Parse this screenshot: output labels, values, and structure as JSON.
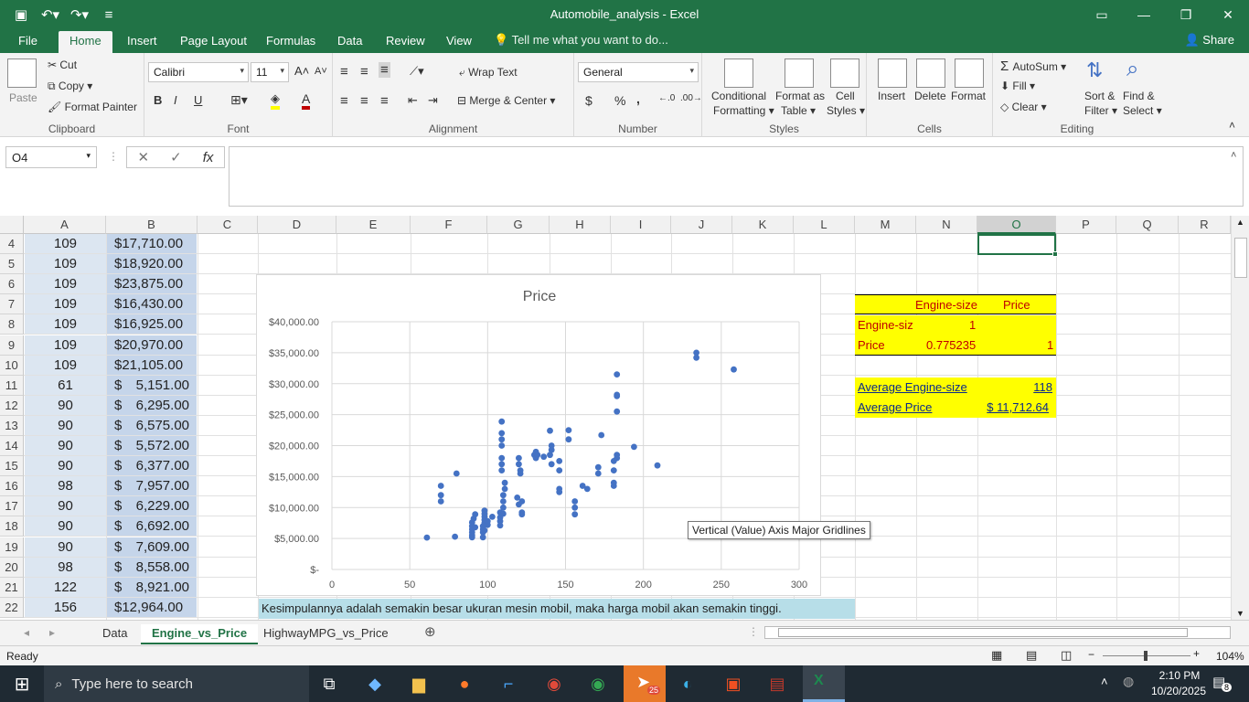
{
  "title_bar": {
    "title": "Automobile_analysis  -  Excel",
    "qat": [
      "save-icon",
      "undo-icon",
      "redo-icon",
      "customize-icon"
    ],
    "window_controls": [
      "ribbon-display-icon",
      "minimize-icon",
      "restore-icon",
      "close-icon"
    ]
  },
  "tabs": {
    "items": [
      "File",
      "Home",
      "Insert",
      "Page Layout",
      "Formulas",
      "Data",
      "Review",
      "View"
    ],
    "active": "Home",
    "tell_me": "Tell me what you want to do...",
    "share": "Share"
  },
  "ribbon": {
    "clipboard": {
      "paste": "Paste",
      "cut": "Cut",
      "copy": "Copy",
      "format_painter": "Format Painter",
      "label": "Clipboard"
    },
    "font": {
      "name": "Calibri",
      "size": "11",
      "bold": "B",
      "italic": "I",
      "underline": "U",
      "label": "Font"
    },
    "alignment": {
      "wrap": "Wrap Text",
      "merge": "Merge & Center",
      "label": "Alignment"
    },
    "number": {
      "format": "General",
      "currency": "$",
      "percent": "%",
      "comma": ",",
      "label": "Number"
    },
    "styles": {
      "conditional": "Conditional",
      "conditional2": "Formatting",
      "format_as": "Format as",
      "format_as2": "Table",
      "cell": "Cell",
      "cell2": "Styles",
      "label": "Styles"
    },
    "cells": {
      "insert": "Insert",
      "delete": "Delete",
      "format": "Format",
      "label": "Cells"
    },
    "editing": {
      "autosum": "AutoSum",
      "fill": "Fill",
      "clear": "Clear",
      "sort": "Sort &",
      "sort2": "Filter",
      "find": "Find &",
      "find2": "Select",
      "label": "Editing"
    }
  },
  "formula_bar": {
    "name_box": "O4",
    "fx": "fx",
    "content": ""
  },
  "columns": [
    "A",
    "B",
    "C",
    "D",
    "E",
    "F",
    "G",
    "H",
    "I",
    "J",
    "K",
    "L",
    "M",
    "N",
    "O",
    "P",
    "Q",
    "R"
  ],
  "selected_column": "O",
  "rows": [
    {
      "n": "4",
      "a": "109",
      "b_cur": "",
      "b": "$17,710.00"
    },
    {
      "n": "5",
      "a": "109",
      "b_cur": "",
      "b": "$18,920.00"
    },
    {
      "n": "6",
      "a": "109",
      "b_cur": "",
      "b": "$23,875.00"
    },
    {
      "n": "7",
      "a": "109",
      "b_cur": "",
      "b": "$16,430.00"
    },
    {
      "n": "8",
      "a": "109",
      "b_cur": "",
      "b": "$16,925.00"
    },
    {
      "n": "9",
      "a": "109",
      "b_cur": "",
      "b": "$20,970.00"
    },
    {
      "n": "10",
      "a": "109",
      "b_cur": "",
      "b": "$21,105.00"
    },
    {
      "n": "11",
      "a": "61",
      "b_cur": "$",
      "b": "5,151.00"
    },
    {
      "n": "12",
      "a": "90",
      "b_cur": "$",
      "b": "6,295.00"
    },
    {
      "n": "13",
      "a": "90",
      "b_cur": "$",
      "b": "6,575.00"
    },
    {
      "n": "14",
      "a": "90",
      "b_cur": "$",
      "b": "5,572.00"
    },
    {
      "n": "15",
      "a": "90",
      "b_cur": "$",
      "b": "6,377.00"
    },
    {
      "n": "16",
      "a": "98",
      "b_cur": "$",
      "b": "7,957.00"
    },
    {
      "n": "17",
      "a": "90",
      "b_cur": "$",
      "b": "6,229.00"
    },
    {
      "n": "18",
      "a": "90",
      "b_cur": "$",
      "b": "6,692.00"
    },
    {
      "n": "19",
      "a": "90",
      "b_cur": "$",
      "b": "7,609.00"
    },
    {
      "n": "20",
      "a": "98",
      "b_cur": "$",
      "b": "8,558.00"
    },
    {
      "n": "21",
      "a": "122",
      "b_cur": "$",
      "b": "8,921.00"
    },
    {
      "n": "22",
      "a": "156",
      "b_cur": "",
      "b": "$12,964.00"
    }
  ],
  "correlation": {
    "header_col1": "Engine-size",
    "header_col2": "Price",
    "row1_label": "Engine-siz",
    "row1_v1": "1",
    "row2_label": "Price",
    "row2_v1": "0.775235",
    "row2_v2": "1",
    "avg_engine_label": "Average Engine-size",
    "avg_engine_value": "118",
    "avg_price_label": "Average Price",
    "avg_price_value": "$ 11,712.64"
  },
  "chart_tooltip": "Vertical (Value) Axis Major Gridlines",
  "conclusion": "Kesimpulannya adalah semakin besar ukuran mesin mobil, maka harga mobil akan semakin tinggi.",
  "sheets": [
    "Data",
    "Engine_vs_Price",
    "HighwayMPG_vs_Price"
  ],
  "active_sheet": "Engine_vs_Price",
  "status": {
    "ready": "Ready",
    "zoom": "104%"
  },
  "taskbar": {
    "search": "Type here to search",
    "time": "2:10 PM",
    "date": "10/20/2025",
    "telegram_badge": "25",
    "notif": "8"
  },
  "chart_data": {
    "type": "scatter",
    "title": "Price",
    "xlim": [
      0,
      300
    ],
    "ylim": [
      0,
      40000
    ],
    "x_ticks": [
      "0",
      "50",
      "100",
      "150",
      "200",
      "250",
      "300"
    ],
    "y_ticks": [
      "$-",
      "$5,000.00",
      "$10,000.00",
      "$15,000.00",
      "$20,000.00",
      "$25,000.00",
      "$30,000.00",
      "$35,000.00",
      "$40,000.00"
    ],
    "grid": true,
    "x": [
      61,
      70,
      70,
      70,
      79,
      80,
      90,
      90,
      90,
      90,
      90,
      90,
      91,
      92,
      92,
      97,
      97,
      97,
      97,
      98,
      98,
      98,
      98,
      98,
      98,
      100,
      100,
      103,
      108,
      108,
      108,
      108,
      109,
      109,
      109,
      109,
      109,
      109,
      109,
      110,
      110,
      110,
      110,
      111,
      111,
      119,
      120,
      120,
      120,
      121,
      121,
      122,
      122,
      122,
      130,
      131,
      131,
      132,
      136,
      140,
      140,
      141,
      141,
      141,
      146,
      146,
      146,
      146,
      152,
      152,
      156,
      156,
      156,
      161,
      164,
      171,
      171,
      173,
      181,
      181,
      181,
      181,
      183,
      183,
      183,
      183,
      183,
      183,
      194,
      209,
      234,
      234,
      258
    ],
    "y": [
      5151,
      11000,
      12000,
      13500,
      5300,
      15500,
      5200,
      5500,
      6000,
      6500,
      7000,
      7600,
      8200,
      8900,
      6800,
      5200,
      6000,
      6500,
      7000,
      7500,
      8000,
      8500,
      9000,
      9500,
      6300,
      7200,
      7800,
      8500,
      7100,
      7800,
      8400,
      9200,
      16000,
      17000,
      18000,
      20000,
      21000,
      22000,
      23875,
      9000,
      10000,
      11000,
      12000,
      13000,
      14000,
      11600,
      10500,
      17000,
      18000,
      16000,
      15500,
      9200,
      8900,
      11000,
      18500,
      18000,
      19000,
      18500,
      18200,
      18500,
      22400,
      19300,
      20000,
      17000,
      17500,
      16000,
      13000,
      12500,
      22500,
      21000,
      8900,
      10000,
      11000,
      13500,
      13000,
      15500,
      16500,
      21700,
      17500,
      16000,
      14000,
      13500,
      31500,
      28200,
      28000,
      25500,
      18500,
      18000,
      19800,
      16800,
      35000,
      34200,
      32300
    ]
  },
  "colors": {
    "excel_green": "#217346",
    "yellow": "#ffff00",
    "blue_fill": "#dce6f1",
    "conclusion_fill": "#b7dee8",
    "marker": "#4472c4"
  }
}
